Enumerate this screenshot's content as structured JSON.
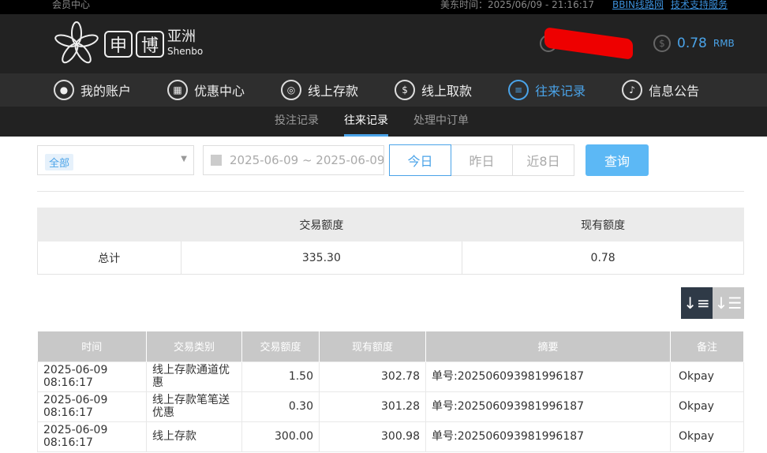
{
  "topbar": {
    "member_center": "会员中心",
    "time": "美东时间：2025/06/09 - 21:16:17",
    "link1": "BBIN线路网",
    "link2": "技术支持服务"
  },
  "header": {
    "logo_char1": "申",
    "logo_char2": "博",
    "logo_cn": "亚洲",
    "logo_en": "Shenbo",
    "balance": "0.78",
    "currency": "RMB"
  },
  "nav": [
    {
      "label": "我的账户",
      "icon": "user-icon"
    },
    {
      "label": "优惠中心",
      "icon": "gift-icon"
    },
    {
      "label": "线上存款",
      "icon": "deposit-icon"
    },
    {
      "label": "线上取款",
      "icon": "withdraw-icon"
    },
    {
      "label": "往来记录",
      "icon": "records-icon",
      "active": true
    },
    {
      "label": "信息公告",
      "icon": "bell-icon"
    }
  ],
  "subnav": [
    {
      "label": "投注记录"
    },
    {
      "label": "往来记录",
      "active": true
    },
    {
      "label": "处理中订单"
    }
  ],
  "filters": {
    "category": "全部",
    "date_range": "2025-06-09 ~ 2025-06-09",
    "today": "今日",
    "yesterday": "昨日",
    "last8": "近8日",
    "query": "查询"
  },
  "summary": {
    "headers": [
      "",
      "交易额度",
      "现有额度"
    ],
    "label": "总计",
    "amount": "335.30",
    "balance": "0.78"
  },
  "table": {
    "headers": [
      "时间",
      "交易类别",
      "交易额度",
      "现有额度",
      "摘要",
      "备注"
    ],
    "rows": [
      [
        "2025-06-09 08:16:17",
        "线上存款通道优惠",
        "1.50",
        "302.78",
        "单号:202506093981996187",
        "Okpay"
      ],
      [
        "2025-06-09 08:16:17",
        "线上存款笔笔送优惠",
        "0.30",
        "301.28",
        "单号:202506093981996187",
        "Okpay"
      ],
      [
        "2025-06-09 08:16:17",
        "线上存款",
        "300.00",
        "300.98",
        "单号:202506093981996187",
        "Okpay"
      ]
    ]
  },
  "colors": {
    "accent": "#4aa3e8",
    "header_bg": "#222222",
    "redaction": "#ee0000"
  }
}
